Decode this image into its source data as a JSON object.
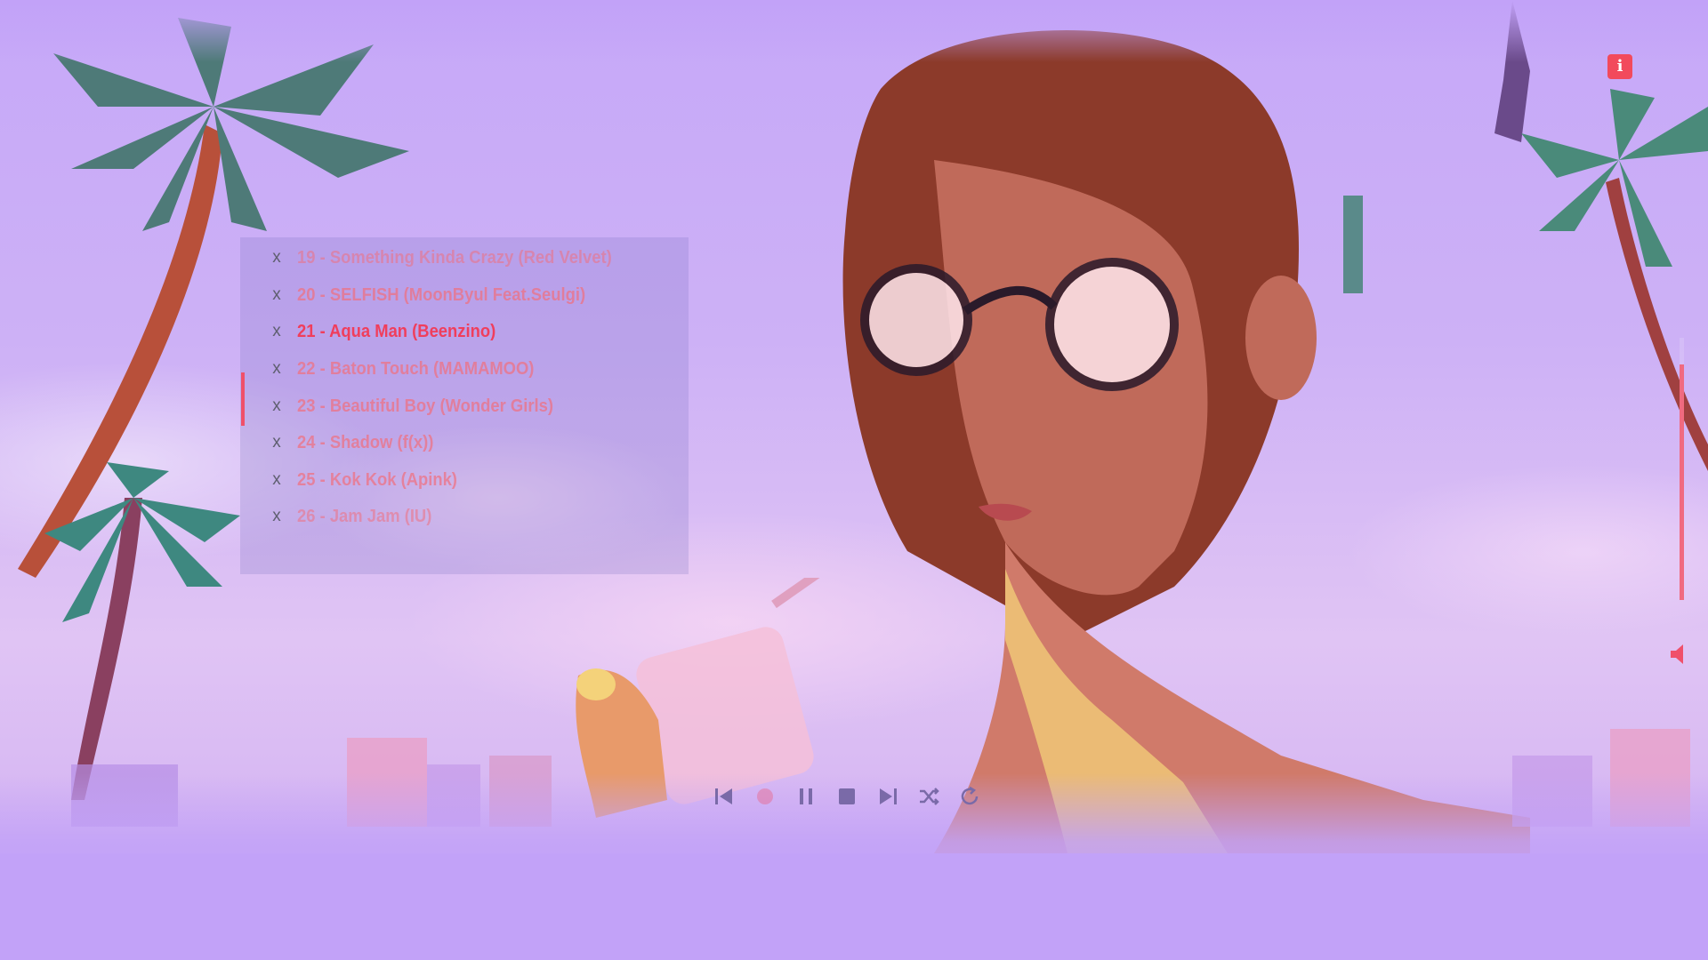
{
  "playlist": {
    "tracks": [
      {
        "remove": "x",
        "title": "19 - Something Kinda Crazy (Red Velvet)"
      },
      {
        "remove": "x",
        "title": "20 - SELFISH (MoonByul Feat.Seulgi)"
      },
      {
        "remove": "x",
        "title": "21 - Aqua Man (Beenzino)"
      },
      {
        "remove": "x",
        "title": "22 - Baton Touch (MAMAMOO)"
      },
      {
        "remove": "x",
        "title": "23 - Beautiful Boy (Wonder Girls)"
      },
      {
        "remove": "x",
        "title": "24 - Shadow (f(x))"
      },
      {
        "remove": "x",
        "title": "25 - Kok Kok (Apink)"
      },
      {
        "remove": "x",
        "title": "26 - Jam Jam (IU)"
      }
    ],
    "current_index": 2
  },
  "volume": {
    "level": 0.9
  },
  "controls": {
    "icons": [
      "skip-previous-icon",
      "play-icon",
      "pause-icon",
      "stop-icon",
      "skip-next-icon",
      "shuffle-icon",
      "repeat-icon"
    ]
  },
  "info_button": {
    "icon": "info-icon",
    "glyph": "i"
  },
  "colors": {
    "background": "#c2a2f8",
    "accent": "#f03e5c",
    "track_text": "#f07080",
    "control_icon": "#7a6aa8"
  }
}
